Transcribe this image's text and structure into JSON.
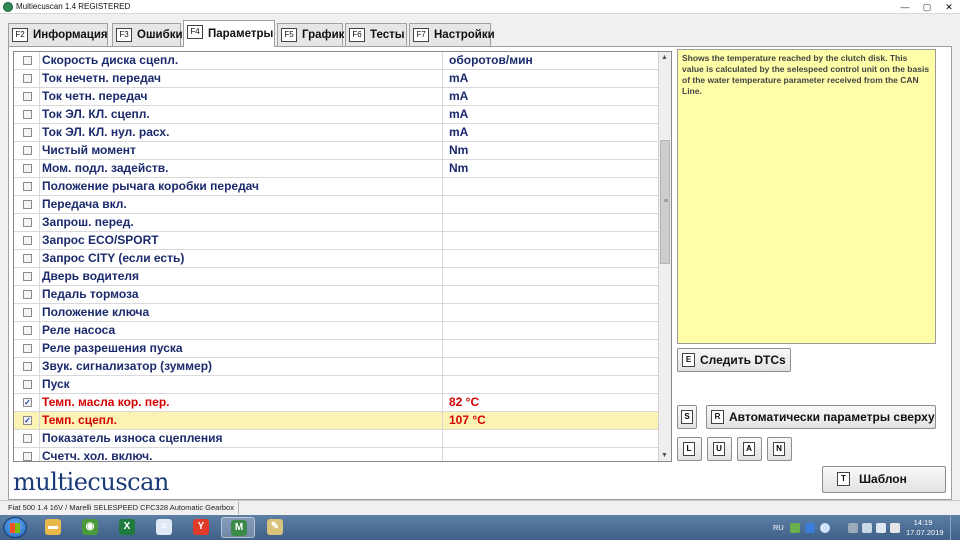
{
  "window": {
    "title": "Multiecuscan 1.4 REGISTERED",
    "controls": {
      "minimize": "—",
      "maximize": "▢",
      "close": "✕"
    }
  },
  "tabs": [
    {
      "key": "F2",
      "label": "Информация"
    },
    {
      "key": "F3",
      "label": "Ошибки"
    },
    {
      "key": "F4",
      "label": "Параметры",
      "active": true
    },
    {
      "key": "F5",
      "label": "График"
    },
    {
      "key": "F6",
      "label": "Тесты"
    },
    {
      "key": "F7",
      "label": "Настройки"
    }
  ],
  "parameters": [
    {
      "name": "Скорость диска сцепл.",
      "value": "оборотов/мин",
      "checked": false
    },
    {
      "name": "Ток нечетн. передач",
      "value": "mA",
      "checked": false
    },
    {
      "name": "Ток четн. передач",
      "value": "mA",
      "checked": false
    },
    {
      "name": "Ток ЭЛ. КЛ. сцепл.",
      "value": "mA",
      "checked": false
    },
    {
      "name": "Ток ЭЛ. КЛ. нул. расх.",
      "value": "mA",
      "checked": false
    },
    {
      "name": "Чистый момент",
      "value": "Nm",
      "checked": false
    },
    {
      "name": "Мом. подл. задейств.",
      "value": "Nm",
      "checked": false
    },
    {
      "name": "Положение рычага коробки передач",
      "value": "",
      "checked": false
    },
    {
      "name": "Передача вкл.",
      "value": "",
      "checked": false
    },
    {
      "name": "Запрош. перед.",
      "value": "",
      "checked": false
    },
    {
      "name": "Запрос ECO/SPORT",
      "value": "",
      "checked": false
    },
    {
      "name": "Запрос CITY (если есть)",
      "value": "",
      "checked": false
    },
    {
      "name": "Дверь водителя",
      "value": "",
      "checked": false
    },
    {
      "name": "Педаль тормоза",
      "value": "",
      "checked": false
    },
    {
      "name": "Положение ключа",
      "value": "",
      "checked": false
    },
    {
      "name": "Реле насоса",
      "value": "",
      "checked": false
    },
    {
      "name": "Реле разрешения пуска",
      "value": "",
      "checked": false
    },
    {
      "name": "Звук. сигнализатор (зуммер)",
      "value": "",
      "checked": false
    },
    {
      "name": "Пуск",
      "value": "",
      "checked": false
    },
    {
      "name": "Темп. масла кор. пер.",
      "value": "82 °C",
      "checked": true,
      "red": true
    },
    {
      "name": "Темп. сцепл.",
      "value": "107 °C",
      "checked": true,
      "red": true,
      "selected": true
    },
    {
      "name": "Показатель износа сцепления",
      "value": "",
      "checked": false
    },
    {
      "name": "Счетч. хол. включ.",
      "value": "",
      "checked": false
    }
  ],
  "description": "Shows the temperature reached by the clutch disk. This value is calculated by the selespeed control unit on the basis of the water temperature parameter received from the CAN Line.",
  "buttons": {
    "follow_dtcs": {
      "key": "E",
      "label": "Следить DTCs"
    },
    "s_key": "S",
    "auto_params": {
      "key": "R",
      "label": "Автоматически параметры сверху"
    },
    "small": [
      "L",
      "U",
      "A",
      "N"
    ],
    "template": {
      "key": "T",
      "label": "Шаблон"
    }
  },
  "logo": "multiecuscan",
  "status": "Fiat 500 1.4 16V / Marelli SELESPEED CFC328 Automatic Gearbox",
  "taskbar": {
    "apps": [
      {
        "icon": "folder-icon",
        "color": "#e8b84a",
        "glyph": "▬"
      },
      {
        "icon": "chrome-icon",
        "color": "#4a9a3a",
        "glyph": "◉"
      },
      {
        "icon": "excel-icon",
        "color": "#1f7a3d",
        "glyph": "X"
      },
      {
        "icon": "notepad-icon",
        "color": "#dfe9f5",
        "glyph": "≡"
      },
      {
        "icon": "yandex-browser-icon",
        "color": "#e23b2a",
        "glyph": "Y"
      },
      {
        "icon": "multiecuscan-icon",
        "color": "#3b8a4a",
        "glyph": "M",
        "active": true
      },
      {
        "icon": "paint-icon",
        "color": "#d9c27a",
        "glyph": "✎"
      }
    ],
    "language": "RU",
    "time": "14:19",
    "date": "17.07.2019"
  }
}
